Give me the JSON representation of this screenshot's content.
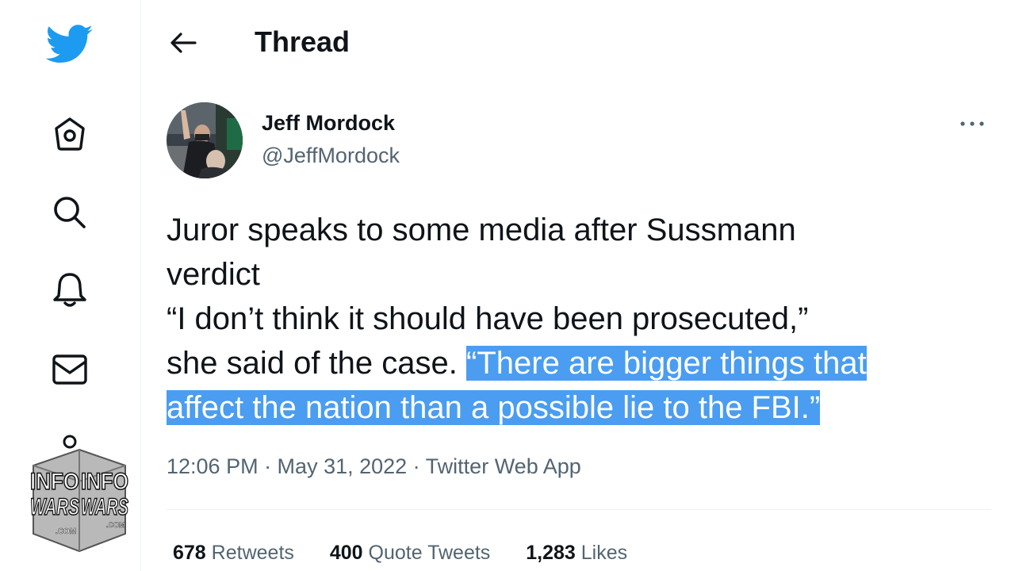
{
  "header": {
    "title": "Thread"
  },
  "tweet": {
    "author_name": "Jeff Mordock",
    "author_handle": "@JeffMordock",
    "text_lines": [
      "Juror speaks to some media after Sussmann",
      "verdict",
      "“I don’t think it should have been prosecuted,”",
      "she said of the case. "
    ],
    "highlight_1": "“There are bigger things that",
    "highlight_2": "affect the nation than a possible lie to the FBI.”",
    "meta": "12:06 PM · May 31, 2022 · Twitter Web App",
    "stats": {
      "retweets_count": "678",
      "retweets_label": "Retweets",
      "quotes_count": "400",
      "quotes_label": "Quote Tweets",
      "likes_count": "1,283",
      "likes_label": "Likes"
    }
  },
  "watermark": {
    "lines": [
      "INFO",
      "WARS"
    ],
    "suffix": ".COM"
  },
  "colors": {
    "brand": "#1d9bf0",
    "highlight": "#4a9df0",
    "text": "#0f1419",
    "muted": "#536471"
  },
  "icons": [
    "twitter-bird-icon",
    "home-icon",
    "search-icon",
    "bell-icon",
    "mail-icon",
    "back-arrow-icon",
    "more-icon"
  ]
}
